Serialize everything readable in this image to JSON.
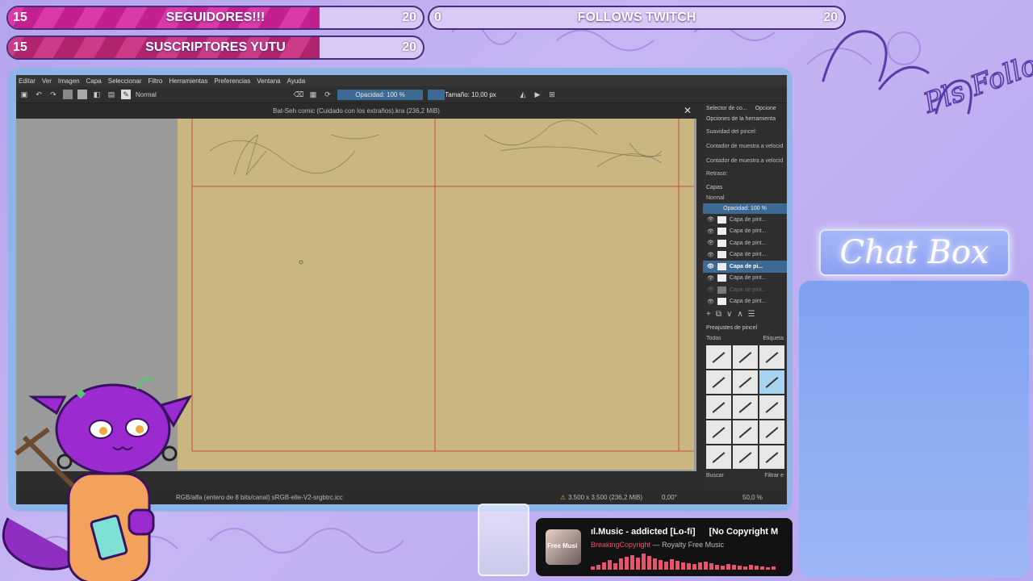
{
  "goals": [
    {
      "title": "SEGUIDORES!!!",
      "current": "15",
      "target": "20",
      "progress": 0.75
    },
    {
      "title": "FOLLOWS TWITCH",
      "current": "0",
      "target": "20",
      "progress": 0.0
    },
    {
      "title": "SUSCRIPTORES YUTU",
      "current": "15",
      "target": "20",
      "progress": 0.75
    }
  ],
  "doodle_text": "Pls Follow!",
  "app": {
    "menu": [
      "Editar",
      "Ver",
      "Imagen",
      "Capa",
      "Seleccionar",
      "Filtro",
      "Herramientas",
      "Preferencias",
      "Ventana",
      "Ayuda"
    ],
    "blend_mode": "Normal",
    "opacity": "Opacidad: 100 %",
    "size": "Tamaño: 10,00 px",
    "document_title": "Bat-Seh comic (Cuidado con los extraños).kra (236,2 MiB)",
    "dock_tabs": [
      "Selector de co...",
      "Opcione"
    ],
    "tool_options": {
      "header": "Opciones de la herramienta",
      "rows": [
        "Suavidad del pincel:",
        "Contador de muestra a velocid",
        "Contador de muestra a velocid",
        "Retraso:"
      ]
    },
    "layers": {
      "header": "Capas",
      "blend": "Normal",
      "opacity": "Opacidad: 100 %",
      "items": [
        "Capa de pint...",
        "Capa de pint...",
        "Capa de pint...",
        "Capa de pint...",
        "Capa de pi...",
        "Capa de pint...",
        "Capa de pint...",
        "Capa de pint..."
      ],
      "selected_index": 4
    },
    "presets": {
      "header": "Preajustes de pincel",
      "filter": "Todas",
      "tag": "Etiqueta",
      "search": "Buscar",
      "filter_check": "Filtrar e"
    },
    "status": {
      "color": "RGB/alfa (entero de 8 bits/canal)  sRGB-elle-V2-srgbtrc.icc",
      "dims": "3.500 x 3.500 (236,2 MiB)",
      "angle": "0,00°",
      "zoom": "50,0 %"
    }
  },
  "chat_box_title": "Chat Box",
  "music": {
    "song": "ıl.Music - addicted [Lo-fi]",
    "song_suffix": "[No Copyright M",
    "artist": "BreakingCopyright",
    "subtitle": "— Royalty Free Music",
    "art_label": "Free Musi"
  },
  "colors": {
    "accent": "#c2208f",
    "frame": "#8fb4ea",
    "paper": "#cab681",
    "guides": "#c94a43",
    "chat": "#8ca0f2"
  }
}
